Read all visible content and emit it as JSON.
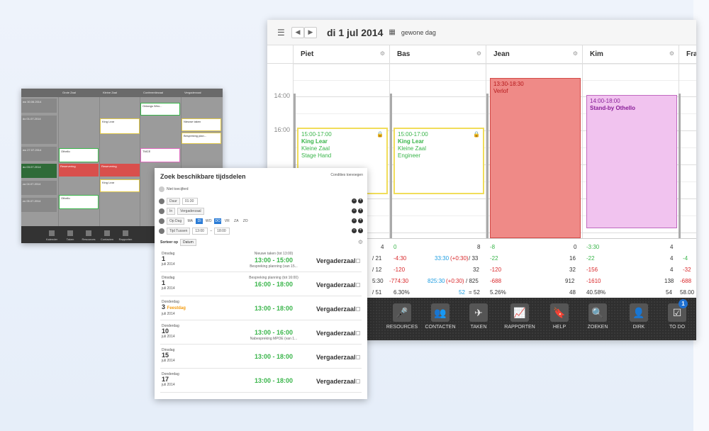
{
  "main": {
    "date": "di 1 jul 2014",
    "day_type": "gewone dag",
    "columns": [
      "Piet",
      "Bas",
      "Jean",
      "Kim",
      "Fra"
    ],
    "times": [
      "14:00",
      "16:00"
    ],
    "events": [
      {
        "time": "15:00-17:00",
        "title": "King Lear",
        "line2": "Kleine Zaal",
        "line3": "Stage Hand"
      },
      {
        "time": "15:00-17:00",
        "title": "King Lear",
        "line2": "Kleine Zaal",
        "line3": "Engineer"
      },
      {
        "time": "13:30-18:30",
        "title": "Verlof"
      },
      {
        "time": "14:00-18:00",
        "title": "Stand-by Othello"
      }
    ],
    "summary": {
      "row1": [
        "4",
        "0",
        "8",
        "0",
        "-8",
        "0",
        "-3:30",
        "4"
      ],
      "row2": [
        "/ 21",
        "-4:30",
        "33:30",
        "(+0:30)",
        "/ 33",
        "-22",
        "16",
        "-22",
        "4",
        "-4"
      ],
      "row3": [
        "/ 12",
        "-120",
        "32",
        "-120",
        "32",
        "-156",
        "4",
        "-32"
      ],
      "row4": [
        "5:30",
        "-774:30",
        "825:30",
        "(+0:30)",
        "/ 825",
        "-688",
        "912",
        "-1610",
        "138",
        "-688"
      ],
      "row5": [
        "/ 51",
        "6.30%",
        "52",
        "= 52",
        "5.26%",
        "48",
        "40.58%",
        "54",
        "58.00"
      ]
    },
    "toolbar": [
      {
        "label": "RESOURCES",
        "icon": "🎤"
      },
      {
        "label": "CONTACTEN",
        "icon": "👥"
      },
      {
        "label": "TAKEN",
        "icon": "✈"
      },
      {
        "label": "RAPPORTEN",
        "icon": "📈"
      },
      {
        "label": "HELP",
        "icon": "🔖"
      },
      {
        "label": "ZOEKEN",
        "icon": "🔍"
      },
      {
        "label": "DIRK",
        "icon": "👤"
      },
      {
        "label": "TO DO",
        "icon": "☑",
        "badge": "1"
      }
    ]
  },
  "small": {
    "columns": [
      "Grote Zaal",
      "Kleine Zaal",
      "Conferentiezaal",
      "Vergaderzaal"
    ],
    "days": [
      "wo 30.06.2014",
      "do 01.07.2014",
      "vr",
      "wo 27.07.2014",
      "do 03.07.2014",
      "vr",
      "za 04.07.2014",
      "zo 05.07.2014"
    ],
    "events": [
      "Onlangs Weo...",
      "King Lear",
      "Nieuwe taken",
      "Bespreking plan...",
      "Othello",
      "TMCE",
      "Reservering",
      "Reservering",
      "King Lear",
      "Othello"
    ],
    "toolbar": [
      "Kalender",
      "Taken",
      "Resources",
      "Contacten",
      "Rapporten"
    ]
  },
  "panel": {
    "title": "Zoek beschikbare tijdsdelen",
    "link": "Condities toevoegen",
    "option": "Niet toecijferd",
    "duur_label": "Duur",
    "duur_value": "01:30",
    "ruimte_label": "In",
    "ruimte_value": "Vergaderzaal",
    "dag_label": "Op Dag",
    "days": [
      "MA",
      "DI",
      "WO",
      "DO",
      "VR",
      "ZA",
      "ZO"
    ],
    "tijd_label": "Tijd Tussen",
    "tijd_from": "13:00",
    "tijd_to": "18:00",
    "sort_label": "Sorteer op",
    "sort_value": "Datum",
    "results": [
      {
        "weekday": "Dinsdag",
        "day": "1",
        "month": "juli 2014",
        "note": "Nieuwe taken (tot 13:00)",
        "time": "13:00 - 15:00",
        "note2": "Bespreking planning (van 15...",
        "room": "Vergaderzaal"
      },
      {
        "weekday": "Dinsdag",
        "day": "1",
        "month": "juli 2014",
        "note": "Bespreking planning (tot 16:00)",
        "time": "16:00 - 18:00",
        "note2": "",
        "room": "Vergaderzaal"
      },
      {
        "weekday": "Donderdag",
        "day": "3",
        "free": "Feestdag",
        "month": "juli 2014",
        "note": "",
        "time": "13:00 - 18:00",
        "note2": "",
        "room": "Vergaderzaal"
      },
      {
        "weekday": "Donderdag",
        "day": "10",
        "month": "juli 2014",
        "note": "",
        "time": "13:00 - 16:00",
        "note2": "Nabespreking MPOE (van 1...",
        "room": "Vergaderzaal"
      },
      {
        "weekday": "Dinsdag",
        "day": "15",
        "month": "juli 2014",
        "note": "",
        "time": "13:00 - 18:00",
        "note2": "",
        "room": "Vergaderzaal"
      },
      {
        "weekday": "Donderdag",
        "day": "17",
        "month": "juli 2014",
        "note": "",
        "time": "13:00 - 18:00",
        "note2": "",
        "room": "Vergaderzaal"
      }
    ]
  }
}
